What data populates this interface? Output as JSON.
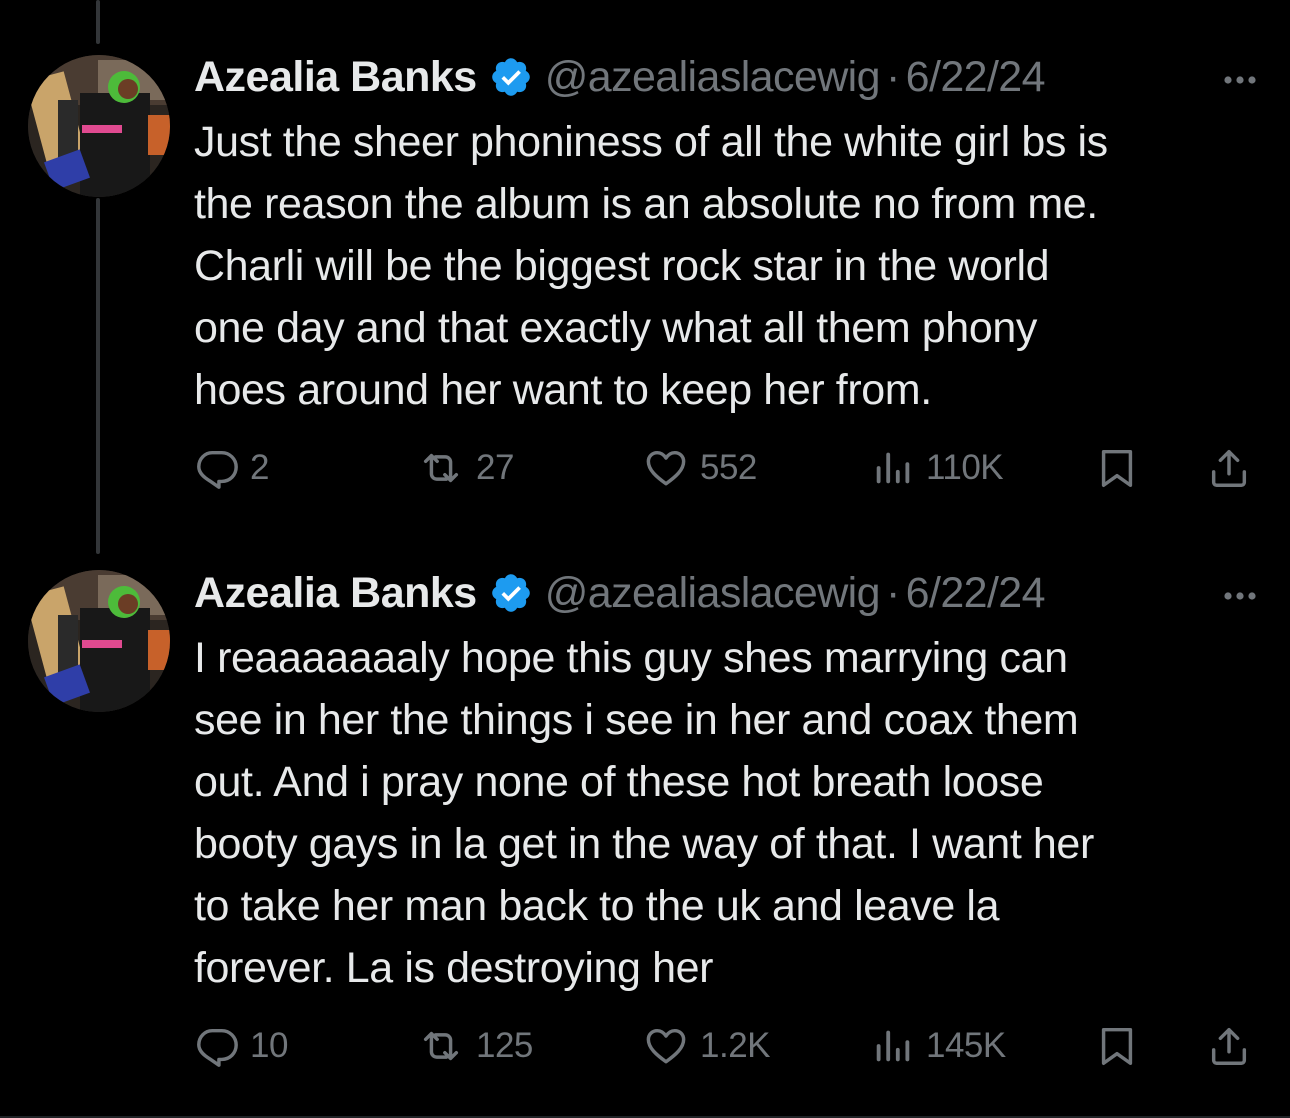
{
  "thread": {
    "tweets": [
      {
        "author_name": "Azealia Banks",
        "handle": "@azealiaslacewig",
        "separator": "·",
        "date": "6/22/24",
        "lines": [
          "Just the sheer phoniness of all the white girl bs is",
          "the reason the album is an absolute no from me.",
          "Charli will be the biggest rock star in the world",
          "one day and that exactly what all them phony",
          "hoes around her want to keep her from."
        ],
        "replies": "2",
        "reposts": "27",
        "likes": "552",
        "views": "110K"
      },
      {
        "author_name": "Azealia Banks",
        "handle": "@azealiaslacewig",
        "separator": "·",
        "date": "6/22/24",
        "lines": [
          "I reaaaaaaaly hope this guy shes marrying can",
          "see in her the things i see in her and coax them",
          "out. And i pray none of these hot breath loose",
          "booty gays in la get in the way of that. I want her",
          "to take her man back to the uk and leave la",
          "forever. La is destroying her"
        ],
        "replies": "10",
        "reposts": "125",
        "likes": "1.2K",
        "views": "145K"
      }
    ]
  },
  "icons": {
    "verified": "verified-badge-icon",
    "more": "more-options-icon",
    "reply": "reply-icon",
    "repost": "repost-icon",
    "like": "heart-icon",
    "views": "views-chart-icon",
    "bookmark": "bookmark-icon",
    "share": "share-icon"
  },
  "colors": {
    "background": "#000000",
    "primary_text": "#e7e9ea",
    "secondary_text": "#71767b",
    "verified_blue": "#1d9bf0",
    "thread_line": "#333639"
  }
}
